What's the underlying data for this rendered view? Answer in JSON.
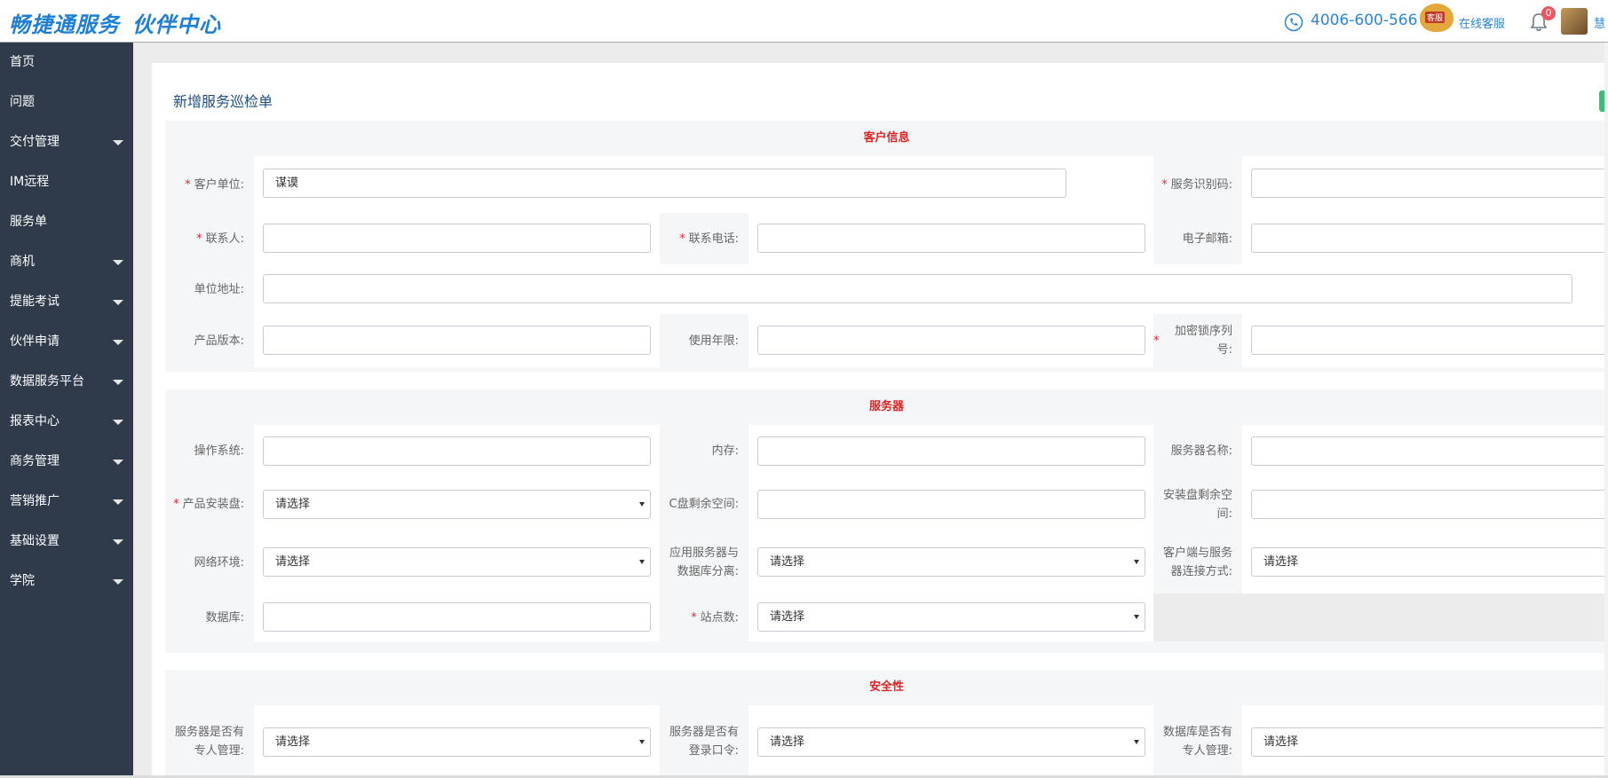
{
  "header": {
    "logo_part1": "畅捷通服务",
    "logo_part2": "伙伴中心",
    "phone": "4006-600-566",
    "cs_badge": "客服",
    "online_service": "在线客服",
    "notification_count": "0",
    "user_name": "慧"
  },
  "sidebar": {
    "items": [
      {
        "label": "首页",
        "has_caret": false
      },
      {
        "label": "问题",
        "has_caret": false
      },
      {
        "label": "交付管理",
        "has_caret": true
      },
      {
        "label": "IM远程",
        "has_caret": false
      },
      {
        "label": "服务单",
        "has_caret": false
      },
      {
        "label": "商机",
        "has_caret": true
      },
      {
        "label": "提能考试",
        "has_caret": true
      },
      {
        "label": "伙伴申请",
        "has_caret": true
      },
      {
        "label": "数据服务平台",
        "has_caret": true
      },
      {
        "label": "报表中心",
        "has_caret": true
      },
      {
        "label": "商务管理",
        "has_caret": true
      },
      {
        "label": "营销推广",
        "has_caret": true
      },
      {
        "label": "基础设置",
        "has_caret": true
      },
      {
        "label": "学院",
        "has_caret": true
      }
    ]
  },
  "page": {
    "title": "新增服务巡检单"
  },
  "customer_info": {
    "heading": "客户信息",
    "customer_unit_label": "客户单位:",
    "customer_unit_value": "谋谟",
    "service_id_label": "服务识别码:",
    "contact_label": "联系人:",
    "contact_phone_label": "联系电话:",
    "email_label": "电子邮箱:",
    "address_label": "单位地址:",
    "product_version_label": "产品版本:",
    "usage_years_label": "使用年限:",
    "lock_serial_label": "加密锁序列号:"
  },
  "server": {
    "heading": "服务器",
    "os_label": "操作系统:",
    "memory_label": "内存:",
    "server_name_label": "服务器名称:",
    "install_disk_label": "产品安装盘:",
    "install_disk_value": "请选择",
    "c_free_label": "C盘剩余空间:",
    "install_free_label": "安装盘剩余空间:",
    "network_label": "网络环境:",
    "network_value": "请选择",
    "app_db_sep_label": "应用服务器与数据库分离:",
    "app_db_sep_value": "请选择",
    "client_conn_label": "客户端与服务器连接方式:",
    "client_conn_value": "请选择",
    "database_label": "数据库:",
    "sites_label": "站点数:",
    "sites_value": "请选择"
  },
  "security": {
    "heading": "安全性",
    "server_admin_label": "服务器是否有专人管理:",
    "server_admin_value": "请选择",
    "server_pwd_label": "服务器是否有登录口令:",
    "server_pwd_value": "请选择",
    "db_admin_label": "数据库是否有专人管理:",
    "db_admin_value": "请选择"
  }
}
